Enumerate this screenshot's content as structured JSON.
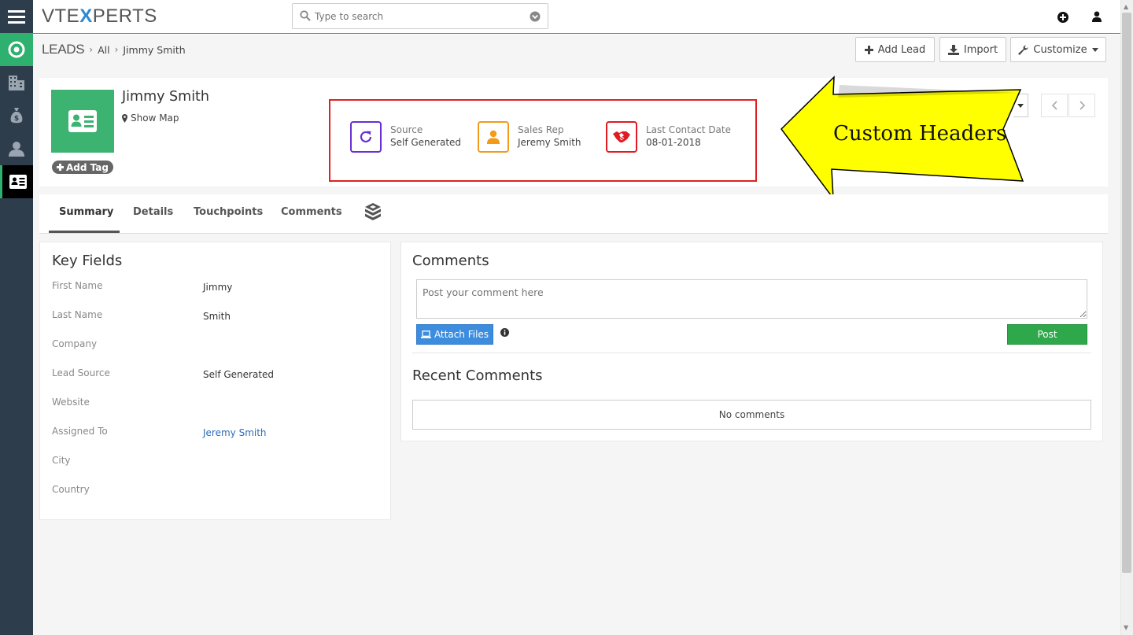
{
  "app": {
    "logo_part1": "VTE",
    "logo_x": "X",
    "logo_part2": "PERTS",
    "search_placeholder": "Type to search"
  },
  "sidebar": {
    "items": [
      {
        "icon": "hamburger-menu-icon"
      },
      {
        "icon": "home-icon"
      },
      {
        "icon": "organization-icon"
      },
      {
        "icon": "money-bag-icon"
      },
      {
        "icon": "contact-icon"
      },
      {
        "icon": "lead-card-icon"
      }
    ]
  },
  "breadcrumb": {
    "module": "LEADS",
    "filter": "All",
    "record": "Jimmy Smith"
  },
  "actions": {
    "add_lead": "Add Lead",
    "import": "Import",
    "customize": "Customize"
  },
  "record": {
    "name": "Jimmy Smith",
    "show_map": "Show Map",
    "add_tag": "Add Tag"
  },
  "custom_headers": [
    {
      "label": "Source",
      "value": "Self Generated",
      "color": "#6a2fd0"
    },
    {
      "label": "Sales Rep",
      "value": "Jeremy Smith",
      "color": "#f19a1b"
    },
    {
      "label": "Last Contact Date",
      "value": "08-01-2018",
      "color": "#e11b22"
    }
  ],
  "callout": {
    "text": "Custom Headers",
    "color": "#ffff00"
  },
  "tabs": {
    "summary": "Summary",
    "details": "Details",
    "touchpoints": "Touchpoints",
    "comments": "Comments"
  },
  "key_fields": {
    "title": "Key Fields",
    "rows": [
      {
        "label": "First Name",
        "value": "Jimmy"
      },
      {
        "label": "Last Name",
        "value": "Smith"
      },
      {
        "label": "Company",
        "value": ""
      },
      {
        "label": "Lead Source",
        "value": "Self Generated"
      },
      {
        "label": "Website",
        "value": ""
      },
      {
        "label": "Assigned To",
        "value": "Jeremy Smith"
      },
      {
        "label": "City",
        "value": ""
      },
      {
        "label": "Country",
        "value": ""
      }
    ]
  },
  "comments": {
    "title": "Comments",
    "placeholder": "Post your comment here",
    "attach": "Attach Files",
    "post": "Post",
    "recent_title": "Recent Comments",
    "empty": "No comments"
  }
}
